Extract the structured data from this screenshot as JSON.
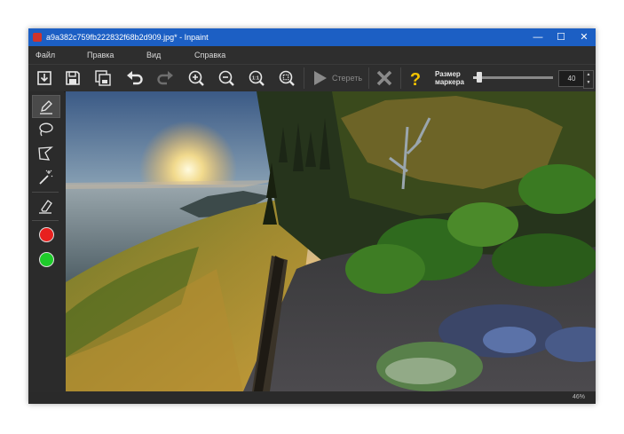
{
  "window": {
    "title": "a9a382c759fb222832f68b2d909.jpg* - Inpaint",
    "controls": {
      "minimize": "—",
      "maximize": "☐",
      "close": "✕"
    }
  },
  "menu": [
    "Файл",
    "Правка",
    "Вид",
    "Справка"
  ],
  "toolbar": {
    "buttons": [
      "open-icon",
      "save-icon",
      "save-as-icon",
      "undo-icon",
      "redo-icon",
      "zoom-in-icon",
      "zoom-out-icon",
      "zoom-actual-icon",
      "zoom-fit-icon"
    ],
    "erase_label": "Стереть",
    "help_symbol": "?",
    "marker_size_label_line1": "Размер",
    "marker_size_label_line2": "маркера",
    "marker_size_value": "40",
    "marker_slider_level_percent": 8
  },
  "left_tools": [
    "marker-icon",
    "lasso-icon",
    "polygon-lasso-icon",
    "magic-wand-icon",
    "eraser-icon"
  ],
  "colors": {
    "red": "#e8201e",
    "green": "#1ecb2a",
    "accent_titlebar": "#1c5fc4"
  },
  "status": {
    "zoom": "46%"
  }
}
